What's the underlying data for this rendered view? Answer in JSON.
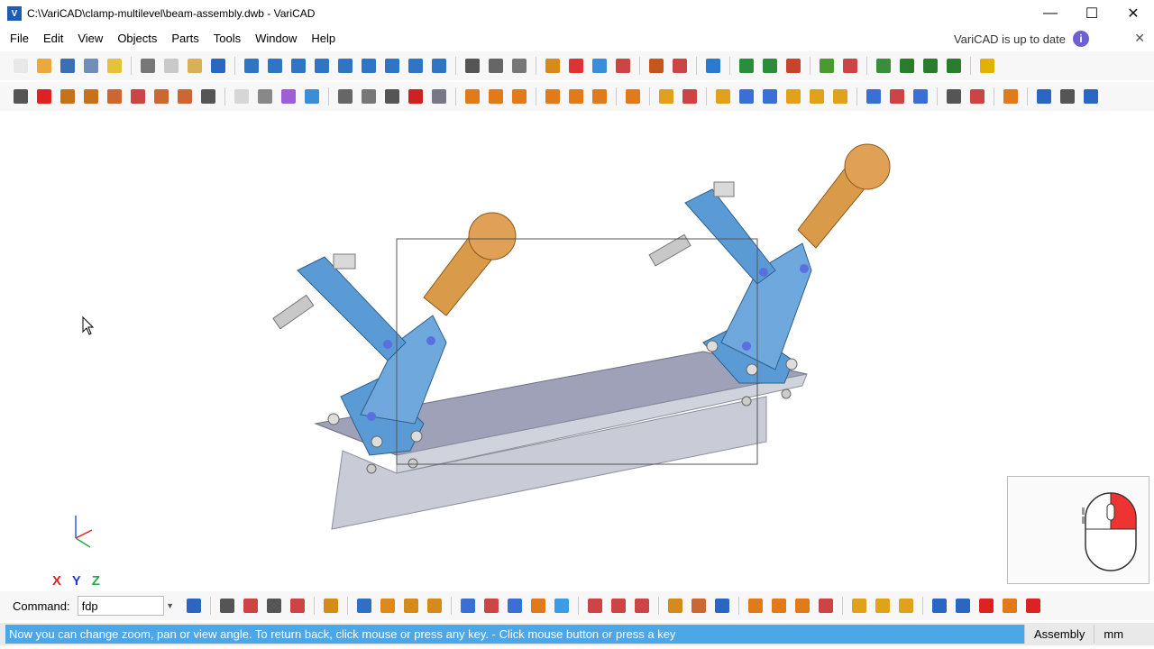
{
  "window": {
    "title": "C:\\VariCAD\\clamp-multilevel\\beam-assembly.dwb - VariCAD",
    "logo_text": "V",
    "controls": {
      "minimize": "—",
      "maximize": "☐",
      "close": "✕"
    }
  },
  "menu": {
    "items": [
      "File",
      "Edit",
      "View",
      "Objects",
      "Parts",
      "Tools",
      "Window",
      "Help"
    ],
    "update_notice": "VariCAD is up to date",
    "info_icon": "i",
    "close": "✕"
  },
  "toolbar_top": [
    {
      "icon": "new-icon",
      "color": "#e8e8e8"
    },
    {
      "icon": "open-icon",
      "color": "#e9a93b"
    },
    {
      "icon": "save-icon",
      "color": "#3b6fb4"
    },
    {
      "icon": "save-all-icon",
      "color": "#6f8fb8"
    },
    {
      "icon": "recent-icon",
      "color": "#e6c23b"
    },
    {
      "sep": true
    },
    {
      "icon": "print-icon",
      "color": "#777"
    },
    {
      "icon": "copy-icon",
      "color": "#c9c9c9"
    },
    {
      "icon": "paste-icon",
      "color": "#d9b05a"
    },
    {
      "icon": "undo-icon",
      "color": "#2a66c2"
    },
    {
      "sep": true
    },
    {
      "icon": "box-icon",
      "color": "#2f75c4"
    },
    {
      "icon": "cylinder-icon",
      "color": "#2f75c4"
    },
    {
      "icon": "prism-icon",
      "color": "#2f75c4"
    },
    {
      "icon": "cone-icon",
      "color": "#2f75c4"
    },
    {
      "icon": "torus-icon",
      "color": "#2f75c4"
    },
    {
      "icon": "pyramid-icon",
      "color": "#2f75c4"
    },
    {
      "icon": "revolve-icon",
      "color": "#2f75c4"
    },
    {
      "icon": "sweep-icon",
      "color": "#2f75c4"
    },
    {
      "icon": "sphere-icon",
      "color": "#2f75c4"
    },
    {
      "sep": true
    },
    {
      "icon": "bolt-icon",
      "color": "#555"
    },
    {
      "icon": "bearing-icon",
      "color": "#666"
    },
    {
      "icon": "spring-icon",
      "color": "#777"
    },
    {
      "sep": true
    },
    {
      "icon": "library-icon",
      "color": "#d58b1a"
    },
    {
      "icon": "magnet-icon",
      "color": "#d33"
    },
    {
      "icon": "transform-icon",
      "color": "#3a8dd6"
    },
    {
      "icon": "array-icon",
      "color": "#c44"
    },
    {
      "sep": true
    },
    {
      "icon": "insert-icon",
      "color": "#c4571b"
    },
    {
      "icon": "group-icon",
      "color": "#c44"
    },
    {
      "sep": true
    },
    {
      "icon": "display-icon",
      "color": "#2a7bd0"
    },
    {
      "sep": true
    },
    {
      "icon": "zoom-window-icon",
      "color": "#2a8d3a"
    },
    {
      "icon": "zoom-all-icon",
      "color": "#2a8d3a"
    },
    {
      "icon": "view-cube-icon",
      "color": "#c6442b"
    },
    {
      "sep": true
    },
    {
      "icon": "layer-icon",
      "color": "#4a9a2f"
    },
    {
      "icon": "layer-red-icon",
      "color": "#c44"
    },
    {
      "sep": true
    },
    {
      "icon": "zoom-fit-icon",
      "color": "#3a8d3a"
    },
    {
      "icon": "zoom-out-icon",
      "color": "#2a7d2a"
    },
    {
      "icon": "pan-left-icon",
      "color": "#2a7d2a"
    },
    {
      "icon": "pan-right-icon",
      "color": "#2a7d2a"
    },
    {
      "sep": true
    },
    {
      "icon": "render-mode-icon",
      "color": "#e2b200"
    }
  ],
  "toolbar_bottom": [
    {
      "icon": "select-icon",
      "color": "#555"
    },
    {
      "icon": "delete-icon",
      "color": "#d22"
    },
    {
      "icon": "move-icon",
      "color": "#c6721b"
    },
    {
      "icon": "rotate-icon",
      "color": "#c6721b"
    },
    {
      "icon": "scale-icon",
      "color": "#c63"
    },
    {
      "icon": "mirror-icon",
      "color": "#c44"
    },
    {
      "icon": "attach-icon",
      "color": "#c63"
    },
    {
      "icon": "detach-icon",
      "color": "#c63"
    },
    {
      "icon": "pick-icon",
      "color": "#555"
    },
    {
      "sep": true
    },
    {
      "icon": "shell-icon",
      "color": "#d6d6d6"
    },
    {
      "icon": "cut-box-icon",
      "color": "#888"
    },
    {
      "icon": "color-icon",
      "color": "#9e5fd6"
    },
    {
      "icon": "material-icon",
      "color": "#3a8dd6"
    },
    {
      "sep": true
    },
    {
      "icon": "bolt2-icon",
      "color": "#666"
    },
    {
      "icon": "thread-icon",
      "color": "#777"
    },
    {
      "icon": "fastener-icon",
      "color": "#555"
    },
    {
      "icon": "red-solid-icon",
      "color": "#c22"
    },
    {
      "icon": "gray-solid-icon",
      "color": "#778"
    },
    {
      "sep": true
    },
    {
      "icon": "bool-add-icon",
      "color": "#e07a1b"
    },
    {
      "icon": "bool-sub-icon",
      "color": "#e07a1b"
    },
    {
      "icon": "bool-int-icon",
      "color": "#e07a1b"
    },
    {
      "sep": true
    },
    {
      "icon": "align-icon",
      "color": "#e07a1b"
    },
    {
      "icon": "align2-icon",
      "color": "#e07a1b"
    },
    {
      "icon": "align3-icon",
      "color": "#e07a1b"
    },
    {
      "sep": true
    },
    {
      "icon": "overlap-icon",
      "color": "#e07a1b"
    },
    {
      "sep": true
    },
    {
      "icon": "query-icon",
      "color": "#e0a21b"
    },
    {
      "icon": "query2-icon",
      "color": "#c44"
    },
    {
      "sep": true
    },
    {
      "icon": "measure-icon",
      "color": "#e0a21b"
    },
    {
      "icon": "distance-icon",
      "color": "#3a6fd6"
    },
    {
      "icon": "angle-icon",
      "color": "#3a6fd6"
    },
    {
      "icon": "check-icon",
      "color": "#e0a21b"
    },
    {
      "icon": "edge-icon",
      "color": "#e0a21b"
    },
    {
      "icon": "fillet-icon",
      "color": "#e0a21b"
    },
    {
      "sep": true
    },
    {
      "icon": "dim-icon",
      "color": "#3a6fd6"
    },
    {
      "icon": "dim2-icon",
      "color": "#c44"
    },
    {
      "icon": "dim3-icon",
      "color": "#3a6fd6"
    },
    {
      "sep": true
    },
    {
      "icon": "assembly-icon",
      "color": "#555"
    },
    {
      "icon": "explode-icon",
      "color": "#c44"
    },
    {
      "sep": true
    },
    {
      "icon": "drawing-icon",
      "color": "#e07a1b"
    },
    {
      "sep": true
    },
    {
      "icon": "2d-icon",
      "color": "#2a66c2"
    },
    {
      "icon": "2d-switch-icon",
      "color": "#555"
    },
    {
      "icon": "3d-switch-icon",
      "color": "#2a66c2"
    }
  ],
  "axis_labels": "X Y Z",
  "command": {
    "label": "Command:",
    "value": "fdp"
  },
  "command_toolbar": [
    {
      "icon": "export-icon",
      "color": "#2a66c2"
    },
    {
      "sep": true
    },
    {
      "icon": "vquery-icon",
      "color": "#555"
    },
    {
      "icon": "squery-icon",
      "color": "#c44"
    },
    {
      "icon": "squery2-icon",
      "color": "#555"
    },
    {
      "icon": "jquery-icon",
      "color": "#c44"
    },
    {
      "sep": true
    },
    {
      "icon": "ruler-icon",
      "color": "#d58b1a"
    },
    {
      "sep": true
    },
    {
      "icon": "solid-blue-icon",
      "color": "#2f6fc4"
    },
    {
      "icon": "solid-orange-icon",
      "color": "#e0881b"
    },
    {
      "icon": "pipe-icon",
      "color": "#d58b1a"
    },
    {
      "icon": "text-icon",
      "color": "#d58b1a"
    },
    {
      "sep": true
    },
    {
      "icon": "grid-icon",
      "color": "#3a6fd6"
    },
    {
      "icon": "array2-icon",
      "color": "#c44"
    },
    {
      "icon": "link-icon",
      "color": "#3a6fd6"
    },
    {
      "icon": "hatch-icon",
      "color": "#e07a1b"
    },
    {
      "icon": "drop-icon",
      "color": "#3a9be6"
    },
    {
      "sep": true
    },
    {
      "icon": "table-icon",
      "color": "#c44"
    },
    {
      "icon": "table2-icon",
      "color": "#c44"
    },
    {
      "icon": "table3-icon",
      "color": "#c44"
    },
    {
      "sep": true
    },
    {
      "icon": "tree-icon",
      "color": "#d58b1a"
    },
    {
      "icon": "tree2-icon",
      "color": "#c63"
    },
    {
      "icon": "target-icon",
      "color": "#2a66c2"
    },
    {
      "sep": true
    },
    {
      "icon": "in-icon",
      "color": "#e07a1b"
    },
    {
      "icon": "out-icon",
      "color": "#e07a1b"
    },
    {
      "icon": "x-orange-icon",
      "color": "#e07a1b"
    },
    {
      "icon": "x-multi-icon",
      "color": "#c44"
    },
    {
      "sep": true
    },
    {
      "icon": "level-up-icon",
      "color": "#e0a21b"
    },
    {
      "icon": "level-dn-icon",
      "color": "#e0a21b"
    },
    {
      "icon": "level-x-icon",
      "color": "#e0a21b"
    },
    {
      "sep": true
    },
    {
      "icon": "check-blue-icon",
      "color": "#2a66c2"
    },
    {
      "icon": "check-x-icon",
      "color": "#2a66c2"
    },
    {
      "icon": "cancel-icon",
      "color": "#d22"
    },
    {
      "icon": "cancel2-icon",
      "color": "#e07a1b"
    },
    {
      "icon": "cancel3-icon",
      "color": "#d22"
    }
  ],
  "status": {
    "message": "Now you can change zoom, pan or view angle. To return back, click mouse or press any key. - Click mouse button or press a key",
    "mode": "Assembly",
    "units": "mm"
  }
}
